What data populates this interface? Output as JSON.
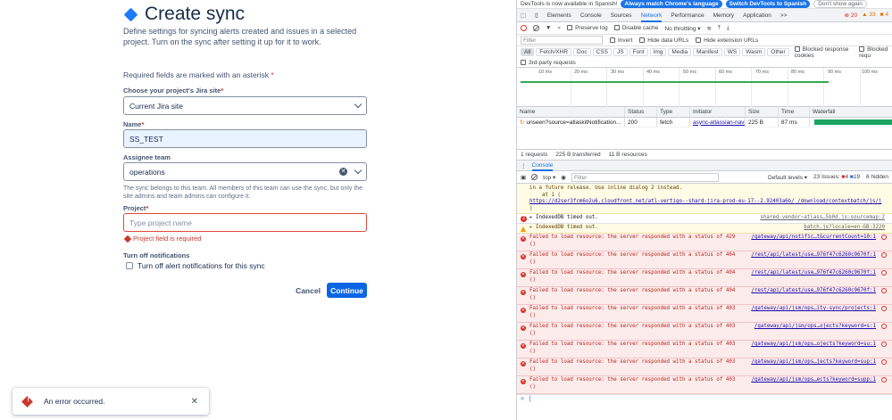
{
  "form": {
    "title": "Create sync",
    "description": "Define settings for syncing alerts created and issues in a selected project. Turn on the sync after setting it up for it to work.",
    "required_note": "Required fields are marked with an asterisk",
    "asterisk": "*",
    "jira_site": {
      "label": "Choose your project's Jira site",
      "value": "Current Jira site"
    },
    "name": {
      "label": "Name",
      "value": "SS_TEST"
    },
    "assignee_team": {
      "label": "Assignee team",
      "value": "operations",
      "help": "The sync belongs to this team. All members of this team can use the sync, but only the site admins and team admins can configure it."
    },
    "project": {
      "label": "Project",
      "placeholder": "Type project name",
      "error": "Project field is required"
    },
    "notifications": {
      "label": "Turn off notifications",
      "checkbox_label": "Turn off alert notifications for this sync"
    },
    "cancel_label": "Cancel",
    "continue_label": "Continue",
    "toast": "An error occurred.",
    "colors": {
      "primary": "#0c66e4",
      "danger": "#c9372c",
      "brand": "#1d7afc"
    }
  },
  "devtools": {
    "infobar": {
      "text": "DevTools is now available in Spanish!",
      "btn1": "Always match Chrome's language",
      "btn2": "Switch DevTools to Spanish",
      "btn3": "Don't show again"
    },
    "tabs": [
      "Elements",
      "Console",
      "Sources",
      "Network",
      "Performance",
      "Memory",
      "Application"
    ],
    "more_tabs": ">>",
    "counts": {
      "errors": "20",
      "warnings": "33",
      "info": "4"
    },
    "toolbar": {
      "preserve_log": "Preserve log",
      "disable_cache": "Disable cache",
      "throttling": "No throttling"
    },
    "filter": {
      "placeholder": "Filter",
      "invert": "Invert",
      "hide_data_urls": "Hide data URLs",
      "hide_ext_urls": "Hide extension URLs"
    },
    "types": [
      "All",
      "Fetch/XHR",
      "Doc",
      "CSS",
      "JS",
      "Font",
      "Img",
      "Media",
      "Manifest",
      "WS",
      "Wasm",
      "Other"
    ],
    "blocked_cookies": "Blocked response cookies",
    "blocked_requests": "Blocked requ",
    "third_party": "3rd-party requests",
    "ticks": [
      "10 ms",
      "20 ms",
      "30 ms",
      "40 ms",
      "50 ms",
      "60 ms",
      "70 ms",
      "80 ms",
      "90 ms",
      "100 ms"
    ],
    "columns": [
      "Name",
      "Status",
      "Type",
      "Initiator",
      "Size",
      "Time",
      "Waterfall"
    ],
    "request": {
      "name": "unseen?source=atlaskitNotification...",
      "status": "200",
      "type": "fetch",
      "initiator": "async-atlassian-navi",
      "size": "225 B",
      "time": "87 ms"
    },
    "summary": {
      "requests": "1 requests",
      "transferred": "225 B transferred",
      "resources": "11 B resources"
    },
    "drawer_tab": "Console",
    "console": {
      "context": "top",
      "filter_placeholder": "Filter",
      "levels": "Default levels",
      "issues": "23 Issues:",
      "issues_err": "4",
      "issues_info": "19",
      "hidden": "6 hidden",
      "intro1": "in a future release. Use inline dialog 2 instead.",
      "intro2": "    at 1 (",
      "intro_link": "https://d2ser3fcm6o2u6.cloudfront.net/atl-vertigo--shard-jira-prod-eu-17--2.92403a6b/ /download/contextbatch/js/j",
      "intro3": ")",
      "idb_count": "2",
      "idb1": "IndexedDB timed out.",
      "idb1_src": "shared-vendor~atlass…5b0d.js:sourcemap:2",
      "idb2": "IndexedDB timed out.",
      "idb2_src": "batch.js?locale=en-GB:3220",
      "errors": [
        {
          "text": "Failed to load resource: the server responded with a status of 429",
          "src": "/gateway/api/notific…t&currentCount=10:1"
        },
        {
          "text": "Failed to load resource: the server responded with a status of 404",
          "src": "/rest/api/latest/use…976f47c6260c9670f:1"
        },
        {
          "text": "Failed to load resource: the server responded with a status of 404",
          "src": "/rest/api/latest/use…976f47c6260c9670f:1"
        },
        {
          "text": "Failed to load resource: the server responded with a status of 404",
          "src": "/rest/api/latest/use…976f47c6260c9670f:1"
        },
        {
          "text": "Failed to load resource: the server responded with a status of 403",
          "src": "/gateway/api/jsm/ops…ity-sync/projects:1"
        },
        {
          "text": "Failed to load resource: the server responded with a status of 403",
          "src": "/gateway/api/jsm/ops…ojects?keyword=s:1"
        },
        {
          "text": "Failed to load resource: the server responded with a status of 403",
          "src": "/gateway/api/jsm/ops…ojects?keyword=su:1"
        },
        {
          "text": "Failed to load resource: the server responded with a status of 403",
          "src": "/gateway/api/jsm/ops…jects?keyword=sup:1"
        },
        {
          "text": "Failed to load resource: the server responded with a status of 403",
          "src": "/gateway/api/jsm/ops…ects?keyword=supp:1"
        }
      ],
      "err_tail": "()",
      "prompt": ">"
    }
  }
}
